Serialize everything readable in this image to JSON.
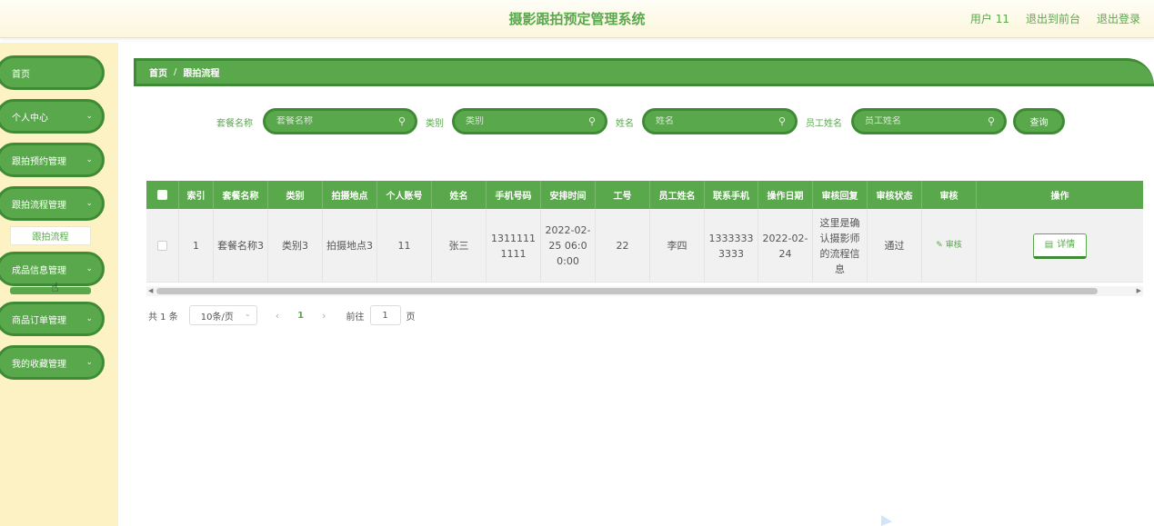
{
  "header": {
    "title": "摄影跟拍预定管理系统",
    "user": "用户 11",
    "to_front": "退出到前台",
    "logout": "退出登录"
  },
  "sidebar": {
    "items": [
      {
        "label": "首页",
        "has_arrow": false
      },
      {
        "label": "个人中心",
        "has_arrow": true
      },
      {
        "label": "跟拍预约管理",
        "has_arrow": true
      },
      {
        "label": "跟拍流程管理",
        "has_arrow": true
      },
      {
        "label": "成品信息管理",
        "has_arrow": true
      },
      {
        "label": "商品订单管理",
        "has_arrow": true
      },
      {
        "label": "我的收藏管理",
        "has_arrow": true
      }
    ],
    "active_sub": "跟拍流程"
  },
  "breadcrumb": {
    "home": "首页",
    "sep": "/",
    "current": "跟拍流程"
  },
  "search": {
    "fields": [
      {
        "label": "套餐名称",
        "placeholder": "套餐名称"
      },
      {
        "label": "类别",
        "placeholder": "类别"
      },
      {
        "label": "姓名",
        "placeholder": "姓名"
      },
      {
        "label": "员工姓名",
        "placeholder": "员工姓名"
      }
    ],
    "button": "查询"
  },
  "table": {
    "headers": [
      "",
      "索引",
      "套餐名称",
      "类别",
      "拍摄地点",
      "个人账号",
      "姓名",
      "手机号码",
      "安排时间",
      "工号",
      "员工姓名",
      "联系手机",
      "操作日期",
      "审核回复",
      "审核状态",
      "审核",
      "操作"
    ],
    "rows": [
      {
        "index": "1",
        "package": "套餐名称3",
        "category": "类别3",
        "location": "拍摄地点3",
        "account": "11",
        "name": "张三",
        "phone": "13111111111",
        "schedule": "2022-02-25 06:00:00",
        "emp_no": "22",
        "emp_name": "李四",
        "contact": "13333333333",
        "op_date": "2022-02-24",
        "reply": "这里是确认摄影师的流程信息",
        "status": "通过",
        "audit": "审核",
        "detail": "详情"
      }
    ]
  },
  "pagination": {
    "total": "共 1 条",
    "page_size": "10条/页",
    "current": "1",
    "goto_label": "前往",
    "goto_value": "1",
    "page_unit": "页"
  },
  "colors": {
    "primary": "#5aa84c",
    "primary_dark": "#3f8b35",
    "sidebar_bg": "#fdf2c4"
  }
}
